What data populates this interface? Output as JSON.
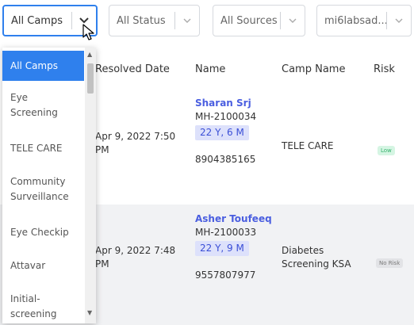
{
  "filters": {
    "camps": "All Camps",
    "status": "All Status",
    "sources": "All Sources",
    "org": "mi6labsad..."
  },
  "table": {
    "headers": {
      "resolved_date": "Resolved Date",
      "name": "Name",
      "camp_name": "Camp Name",
      "risk": "Risk"
    },
    "rows": [
      {
        "resolved_date_line1": "Apr 9, 2022 7:50",
        "resolved_date_line2": "PM",
        "name": "Sharan Srj",
        "id": "MH-2100034",
        "age": "22 Y, 6 M",
        "phone": "8904385165",
        "camp": "TELE CARE",
        "camp_line2": "",
        "risk": "Low"
      },
      {
        "resolved_date_line1": "Apr 9, 2022 7:48",
        "resolved_date_line2": "PM",
        "name": "Asher Toufeeq",
        "id": "MH-2100033",
        "age": "22 Y, 9 M",
        "phone": "9557807977",
        "camp": "Diabetes",
        "camp_line2": "Screening KSA",
        "risk": "No Risk"
      }
    ]
  },
  "dropdown": {
    "items": [
      {
        "line1": "All Camps",
        "line2": ""
      },
      {
        "line1": "Eye",
        "line2": "Screening"
      },
      {
        "line1": "TELE CARE",
        "line2": ""
      },
      {
        "line1": "Community",
        "line2": "Surveillance"
      },
      {
        "line1": "Eye Checkip",
        "line2": ""
      },
      {
        "line1": "Attavar",
        "line2": ""
      },
      {
        "line1": "Initial-",
        "line2": "screening"
      }
    ]
  },
  "colors": {
    "accent": "#2f80ed",
    "patient_name": "#4a5ee0",
    "risk_low": "#37b36d"
  }
}
